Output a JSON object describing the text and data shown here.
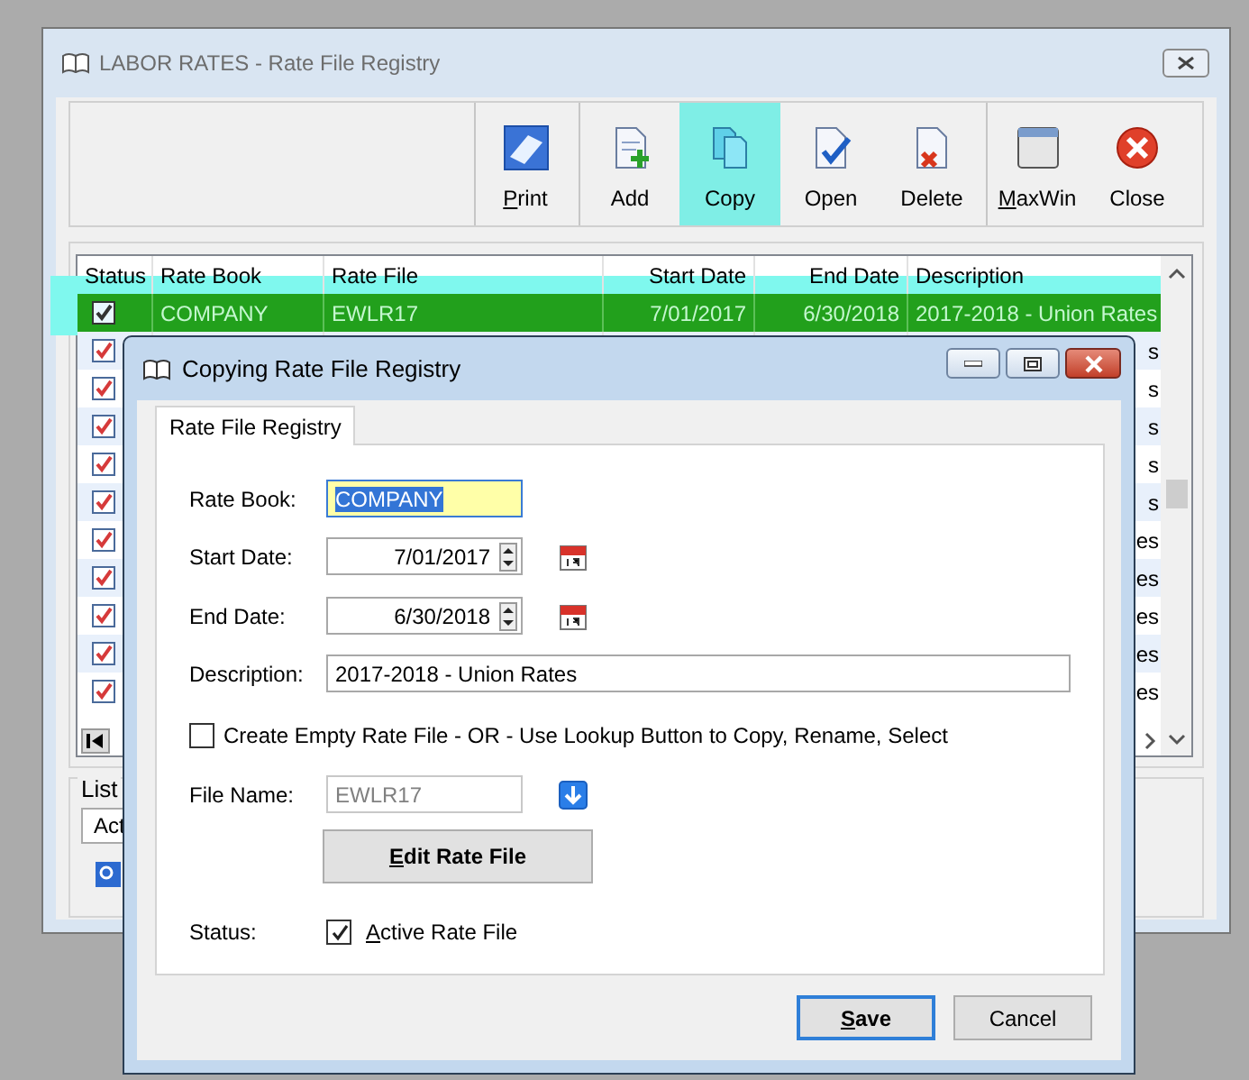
{
  "main_window": {
    "title": "LABOR RATES - Rate File Registry",
    "toolbar": [
      {
        "label": "Print",
        "kind": "print",
        "mnemonic": true,
        "separator_before": true,
        "selected": false
      },
      {
        "label": "Add",
        "kind": "add",
        "mnemonic": false,
        "separator_before": true,
        "selected": false
      },
      {
        "label": "Copy",
        "kind": "copy",
        "mnemonic": false,
        "separator_before": false,
        "selected": true
      },
      {
        "label": "Open",
        "kind": "open",
        "mnemonic": false,
        "separator_before": false,
        "selected": false
      },
      {
        "label": "Delete",
        "kind": "delete",
        "mnemonic": false,
        "separator_before": false,
        "selected": false
      },
      {
        "label": "MaxWin",
        "kind": "maxwin",
        "mnemonic": true,
        "separator_before": true,
        "selected": false
      },
      {
        "label": "Close",
        "kind": "close",
        "mnemonic": false,
        "separator_before": false,
        "selected": false
      }
    ],
    "grid": {
      "columns": [
        "Status",
        "Rate Book",
        "Rate File",
        "Start Date",
        "End Date",
        "Description"
      ],
      "rows": [
        {
          "checked": true,
          "selected": true,
          "rate_book": "COMPANY",
          "rate_file": "EWLR17",
          "start_date": "7/01/2017",
          "end_date": "6/30/2018",
          "description": "2017-2018 - Union Rates"
        },
        {
          "checked": true,
          "selected": false,
          "description": "s"
        },
        {
          "checked": true,
          "selected": false,
          "description": "s"
        },
        {
          "checked": true,
          "selected": false,
          "description": "s"
        },
        {
          "checked": true,
          "selected": false,
          "description": "s"
        },
        {
          "checked": true,
          "selected": false,
          "description": "s"
        },
        {
          "checked": true,
          "selected": false,
          "description": "es"
        },
        {
          "checked": true,
          "selected": false,
          "description": "es"
        },
        {
          "checked": true,
          "selected": false,
          "description": "es"
        },
        {
          "checked": true,
          "selected": false,
          "description": "es"
        },
        {
          "checked": true,
          "selected": false,
          "description": "es"
        }
      ]
    },
    "list_group": {
      "label": "List",
      "combo_value": "Act"
    }
  },
  "dialog": {
    "title": "Copying Rate File Registry",
    "tabs": [
      {
        "label": "Rate File Registry",
        "selected": true
      }
    ],
    "fields": [
      {
        "kind": "text",
        "label": "Rate Book:",
        "value": "COMPANY",
        "focused": true
      },
      {
        "kind": "date",
        "label": "Start Date:",
        "value": "7/01/2017",
        "focused": false
      },
      {
        "kind": "date",
        "label": "End Date:",
        "value": "6/30/2018",
        "focused": false
      },
      {
        "kind": "wide",
        "label": "Description:",
        "value": "2017-2018 - Union Rates",
        "focused": false
      }
    ],
    "create_empty": {
      "label": "Create Empty Rate File - OR - Use Lookup Button to Copy, Rename, Select",
      "checked": false
    },
    "file_name": {
      "label": "File Name:",
      "value": "EWLR17",
      "disabled": true
    },
    "edit_button": {
      "label": "Edit Rate File",
      "mnemonic": true
    },
    "status": {
      "label": "Status:",
      "checkbox_label": "Active Rate File",
      "checked": true,
      "mnemonic": true
    },
    "buttons": [
      {
        "label": "Save",
        "default": true,
        "mnemonic": true
      },
      {
        "label": "Cancel",
        "default": false,
        "mnemonic": false
      }
    ]
  }
}
